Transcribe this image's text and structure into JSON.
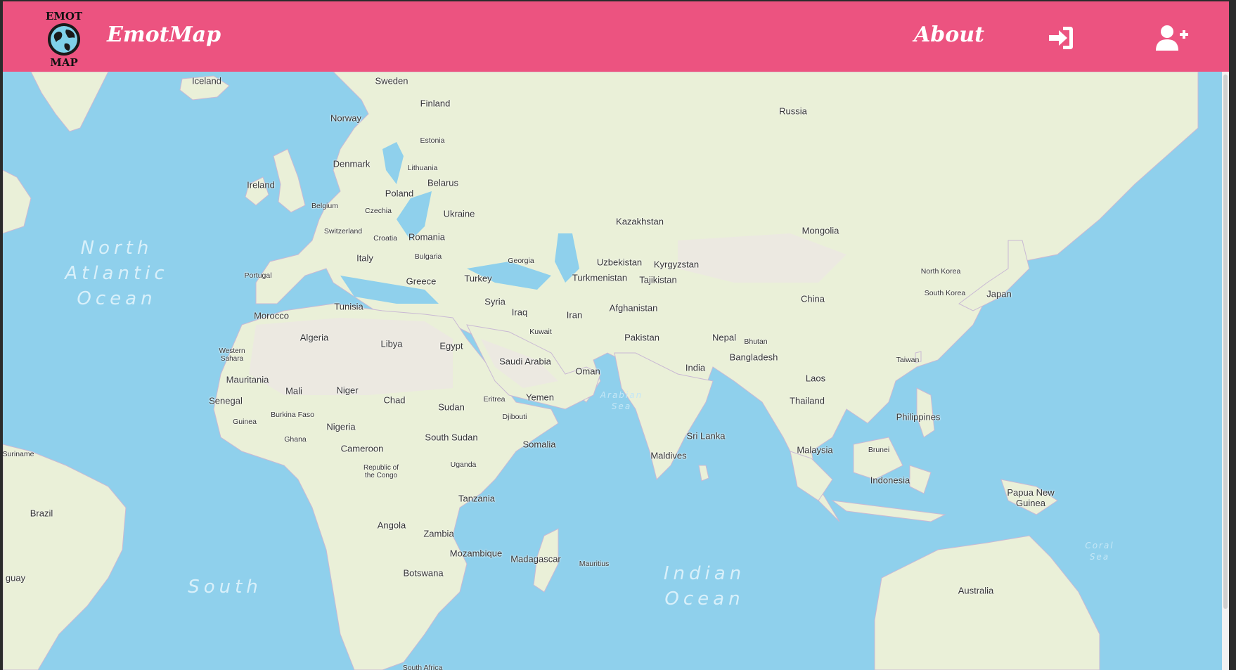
{
  "header": {
    "logo_text_top": "EMOT",
    "logo_text_bottom": "MAP",
    "brand": "EmotMap",
    "about_label": "About",
    "login_icon": "sign-in-icon",
    "register_icon": "user-plus-icon",
    "background_color": "#ec5380"
  },
  "map": {
    "water_color": "#8fd0ec",
    "land_color": "#eaf0d8",
    "oceans": {
      "north_atlantic": "North\nAtlantic\nOcean",
      "south_atlantic": "South",
      "indian": "Indian\nOcean"
    },
    "seas": {
      "arabian": "Arabian\nSea",
      "coral": "Coral\nSea"
    },
    "countries": {
      "iceland": "Iceland",
      "sweden": "Sweden",
      "finland": "Finland",
      "norway": "Norway",
      "russia": "Russia",
      "estonia": "Estonia",
      "denmark": "Denmark",
      "lithuania": "Lithuania",
      "ireland": "Ireland",
      "belarus": "Belarus",
      "poland": "Poland",
      "belgium": "Belgium",
      "czechia": "Czechia",
      "ukraine": "Ukraine",
      "kazakhstan": "Kazakhstan",
      "mongolia": "Mongolia",
      "switzerland": "Switzerland",
      "croatia": "Croatia",
      "romania": "Romania",
      "italy": "Italy",
      "bulgaria": "Bulgaria",
      "georgia": "Georgia",
      "uzbekistan": "Uzbekistan",
      "kyrgyzstan": "Kyrgyzstan",
      "portugal": "Portugal",
      "turkey": "Turkey",
      "greece": "Greece",
      "turkmenistan": "Turkmenistan",
      "tajikistan": "Tajikistan",
      "north_korea": "North Korea",
      "south_korea": "South Korea",
      "japan": "Japan",
      "china": "China",
      "tunisia": "Tunisia",
      "syria": "Syria",
      "iraq": "Iraq",
      "iran": "Iran",
      "afghanistan": "Afghanistan",
      "morocco": "Morocco",
      "algeria": "Algeria",
      "libya": "Libya",
      "egypt": "Egypt",
      "kuwait": "Kuwait",
      "pakistan": "Pakistan",
      "nepal": "Nepal",
      "bhutan": "Bhutan",
      "western_sahara": "Western\nSahara",
      "saudi_arabia": "Saudi Arabia",
      "bangladesh": "Bangladesh",
      "taiwan": "Taiwan",
      "oman": "Oman",
      "india": "India",
      "mauritania": "Mauritania",
      "mali": "Mali",
      "niger": "Niger",
      "laos": "Laos",
      "eritrea": "Eritrea",
      "yemen": "Yemen",
      "chad": "Chad",
      "sudan": "Sudan",
      "senegal": "Senegal",
      "thailand": "Thailand",
      "philippines": "Philippines",
      "burkina_faso": "Burkina Faso",
      "djibouti": "Djibouti",
      "guinea": "Guinea",
      "nigeria": "Nigeria",
      "sri_lanka": "Sri Lanka",
      "ghana": "Ghana",
      "south_sudan": "South Sudan",
      "somalia": "Somalia",
      "suriname": "Suriname",
      "cameroon": "Cameroon",
      "malaysia": "Malaysia",
      "brunei": "Brunei",
      "maldives": "Maldives",
      "uganda": "Uganda",
      "republic_congo": "Republic of\nthe Congo",
      "indonesia": "Indonesia",
      "papua_new_guinea": "Papua New\nGuinea",
      "tanzania": "Tanzania",
      "brazil": "Brazil",
      "angola": "Angola",
      "zambia": "Zambia",
      "mozambique": "Mozambique",
      "madagascar": "Madagascar",
      "mauritius": "Mauritius",
      "botswana": "Botswana",
      "paraguay": "guay",
      "australia": "Australia",
      "south_africa": "South Africa"
    }
  }
}
